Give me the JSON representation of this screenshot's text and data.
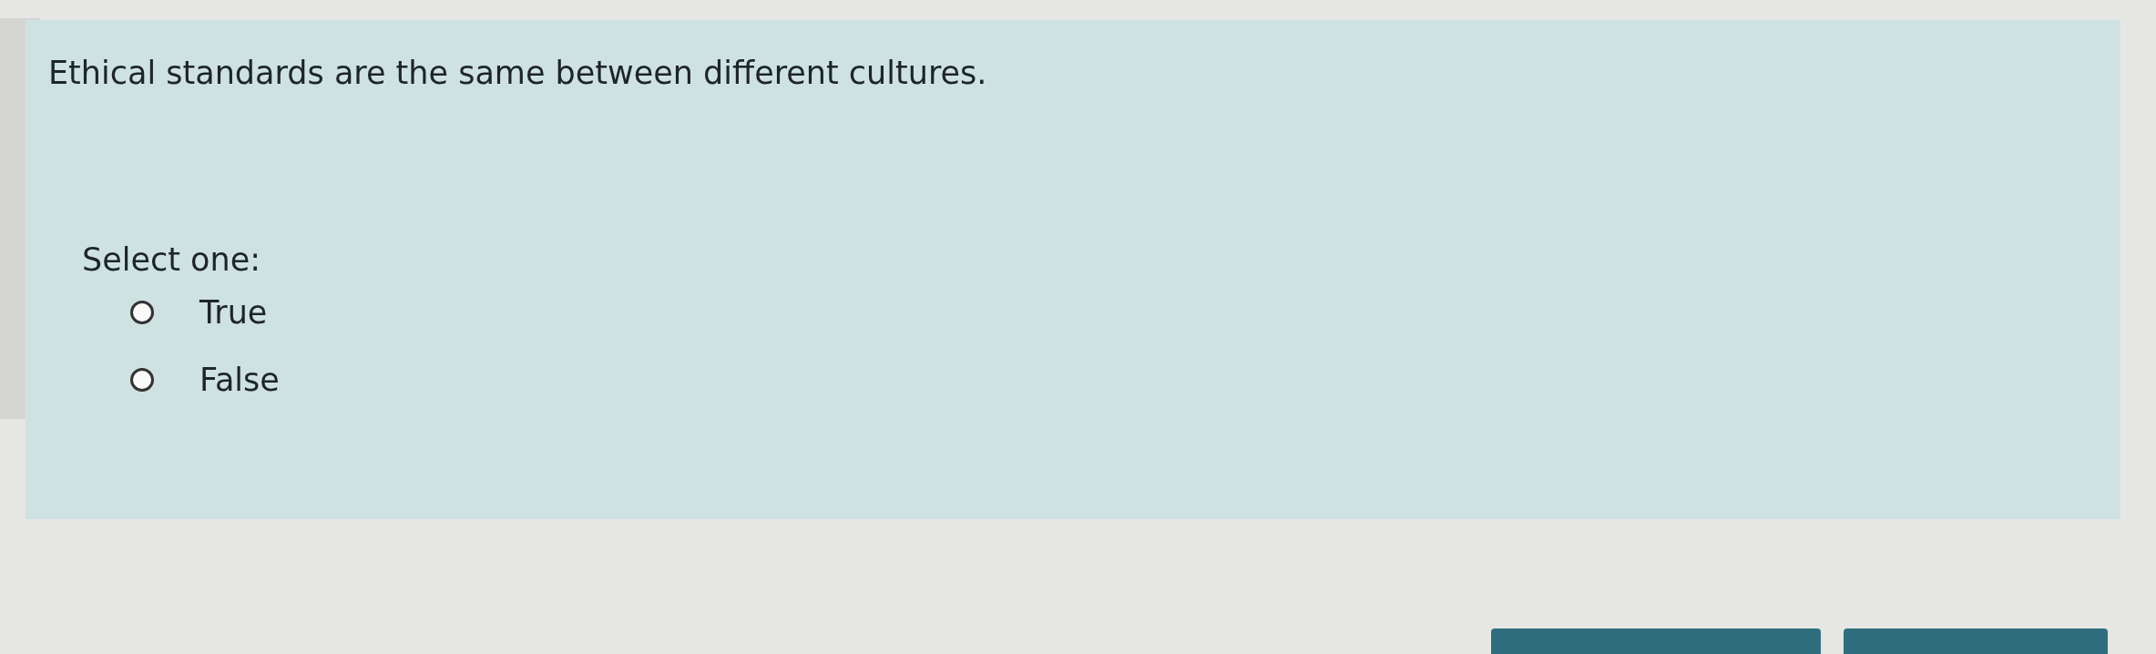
{
  "question": {
    "text": "Ethical standards are the same between different cultures.",
    "prompt": "Select one:",
    "options": [
      {
        "label": "True",
        "selected": false
      },
      {
        "label": "False",
        "selected": false
      }
    ]
  }
}
